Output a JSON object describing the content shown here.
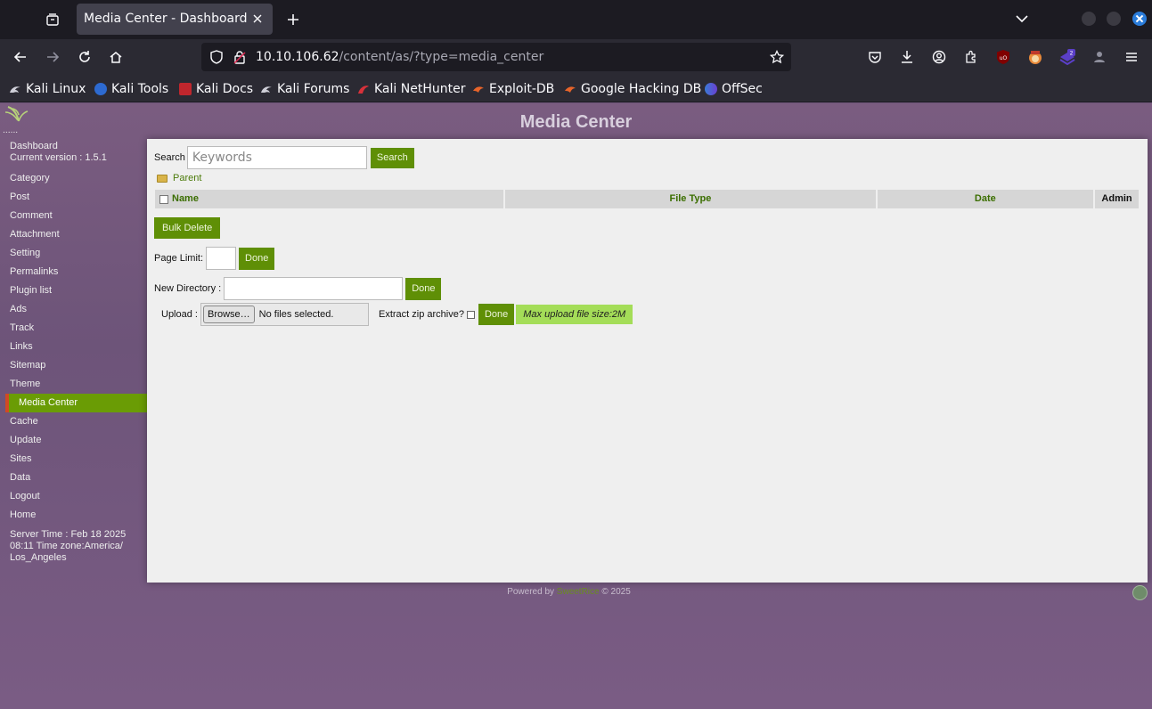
{
  "browser": {
    "tab_title": "Media Center - Dashboard",
    "url_host": "10.10.106.62",
    "url_path": "/content/as/?type=media_center",
    "bookmarks": [
      {
        "label": "Kali Linux",
        "icon": "kali-dragon-icon"
      },
      {
        "label": "Kali Tools",
        "icon": "kali-tools-icon"
      },
      {
        "label": "Kali Docs",
        "icon": "kali-docs-icon"
      },
      {
        "label": "Kali Forums",
        "icon": "kali-dragon-icon"
      },
      {
        "label": "Kali NetHunter",
        "icon": "nethunter-icon"
      },
      {
        "label": "Exploit-DB",
        "icon": "exploit-db-icon"
      },
      {
        "label": "Google Hacking DB",
        "icon": "ghdb-icon"
      },
      {
        "label": "OffSec",
        "icon": "offsec-icon"
      }
    ],
    "extension_badge": "2"
  },
  "page": {
    "title": "Media Center",
    "logo_dots": "......",
    "sidebar": {
      "dashboard": "Dashboard",
      "version": "Current version : 1.5.1",
      "items": [
        {
          "label": "Category"
        },
        {
          "label": "Post"
        },
        {
          "label": "Comment"
        },
        {
          "label": "Attachment"
        },
        {
          "label": "Setting"
        },
        {
          "label": "Permalinks"
        },
        {
          "label": "Plugin list"
        },
        {
          "label": "Ads"
        },
        {
          "label": "Track"
        },
        {
          "label": "Links"
        },
        {
          "label": "Sitemap"
        },
        {
          "label": "Theme"
        },
        {
          "label": "Media Center",
          "active": true
        },
        {
          "label": "Cache"
        },
        {
          "label": "Update"
        },
        {
          "label": "Sites"
        },
        {
          "label": "Data"
        },
        {
          "label": "Logout"
        },
        {
          "label": "Home"
        }
      ],
      "server_time": "Server Time : Feb 18 2025 08:11 Time zone:America/ Los_Angeles"
    },
    "media": {
      "search_label": "Search",
      "search_placeholder": "Keywords",
      "search_button": "Search",
      "parent_link": "Parent",
      "columns": {
        "name": "Name",
        "file_type": "File Type",
        "date": "Date",
        "admin": "Admin"
      },
      "bulk_delete": "Bulk Delete",
      "page_limit_label": "Page Limit:",
      "page_limit_value": "",
      "done": "Done",
      "new_dir_label": "New Directory :",
      "new_dir_value": "",
      "upload_label": "Upload :",
      "browse_button": "Browse…",
      "no_file": "No files selected.",
      "extract_zip": "Extract zip archive?",
      "max_upload": "Max upload file size:2M"
    },
    "footer": {
      "powered_by": "Powered by",
      "brand": "SweetRice",
      "copyright": "© 2025"
    }
  },
  "colors": {
    "accent_green": "#5f8f06",
    "active_marker": "#d04a24",
    "page_bg": "#6e5478"
  }
}
